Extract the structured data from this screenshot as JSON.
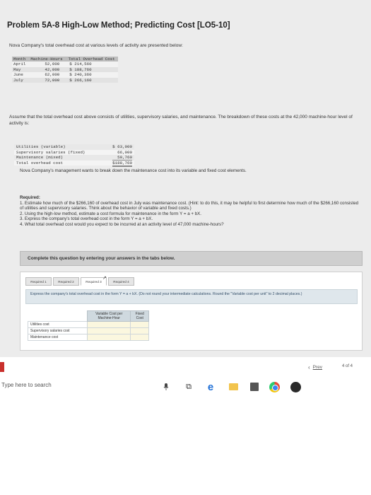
{
  "problem": {
    "title": "Problem 5A-8 High-Low Method; Predicting Cost [LO5-10]",
    "intro": "Nova Company's total overhead cost at various levels of activity are presented below:"
  },
  "activity_table": {
    "headers": {
      "month": "Month",
      "hours": "Machine-Hours",
      "cost": "Total Overhead Cost"
    },
    "rows": [
      {
        "month": "April",
        "hours": "52,000",
        "cost": "$ 214,560"
      },
      {
        "month": "May",
        "hours": "42,000",
        "cost": "$ 188,760"
      },
      {
        "month": "June",
        "hours": "62,000",
        "cost": "$ 240,360"
      },
      {
        "month": "July",
        "hours": "72,000",
        "cost": "$ 266,160"
      }
    ]
  },
  "assume_text": "Assume that the total overhead cost above consists of utilities, supervisory salaries, and maintenance. The breakdown of these costs at the 42,000 machine-hour level of activity is:",
  "breakdown_table": {
    "rows": [
      {
        "label": "Utilities (variable)",
        "value": "$ 63,000"
      },
      {
        "label": "Supervisory salaries (fixed)",
        "value": "66,000"
      },
      {
        "label": "Maintenance (mixed)",
        "value": "59,760"
      },
      {
        "label": "Total overhead cost",
        "value": "$188,760"
      }
    ]
  },
  "mgmt_text": "Nova Company's management wants to break down the maintenance cost into its variable and fixed cost elements.",
  "required": {
    "heading": "Required:",
    "items": [
      "1. Estimate how much of the $266,160 of overhead cost in July was maintenance cost. (Hint: to do this, it may be helpful to first determine how much of the $266,160 consisted of utilities and supervisory salaries. Think about the behavior of variable and fixed costs.)",
      "2. Using the high-low method, estimate a cost formula for maintenance in the form Y = a + bX.",
      "3. Express the company's total overhead cost in the form Y = a + bX.",
      "4. What total overhead cost would you expect to be incurred at an activity level of 47,000 machine-hours?"
    ]
  },
  "instructions": "Complete this question by entering your answers in the tabs below.",
  "tabs": [
    "Required 1",
    "Required 2",
    "Required 3",
    "Required 4"
  ],
  "express_text": "Express the company's total overhead cost in the form Y = a + bX. (Do not round your intermediate calculations. Round the \"Variable cost per unit\" to 2 decimal places.)",
  "answer_table": {
    "col_variable": "Variable Cost per Machine-Hour",
    "col_fixed": "Fixed Cost",
    "rows": [
      "Utilities cost",
      "Supervisory salaries cost",
      "Maintenance cost"
    ]
  },
  "nav": {
    "prev": "Prev",
    "page": "4 of 4"
  },
  "taskbar": {
    "search": "Type here to search"
  }
}
